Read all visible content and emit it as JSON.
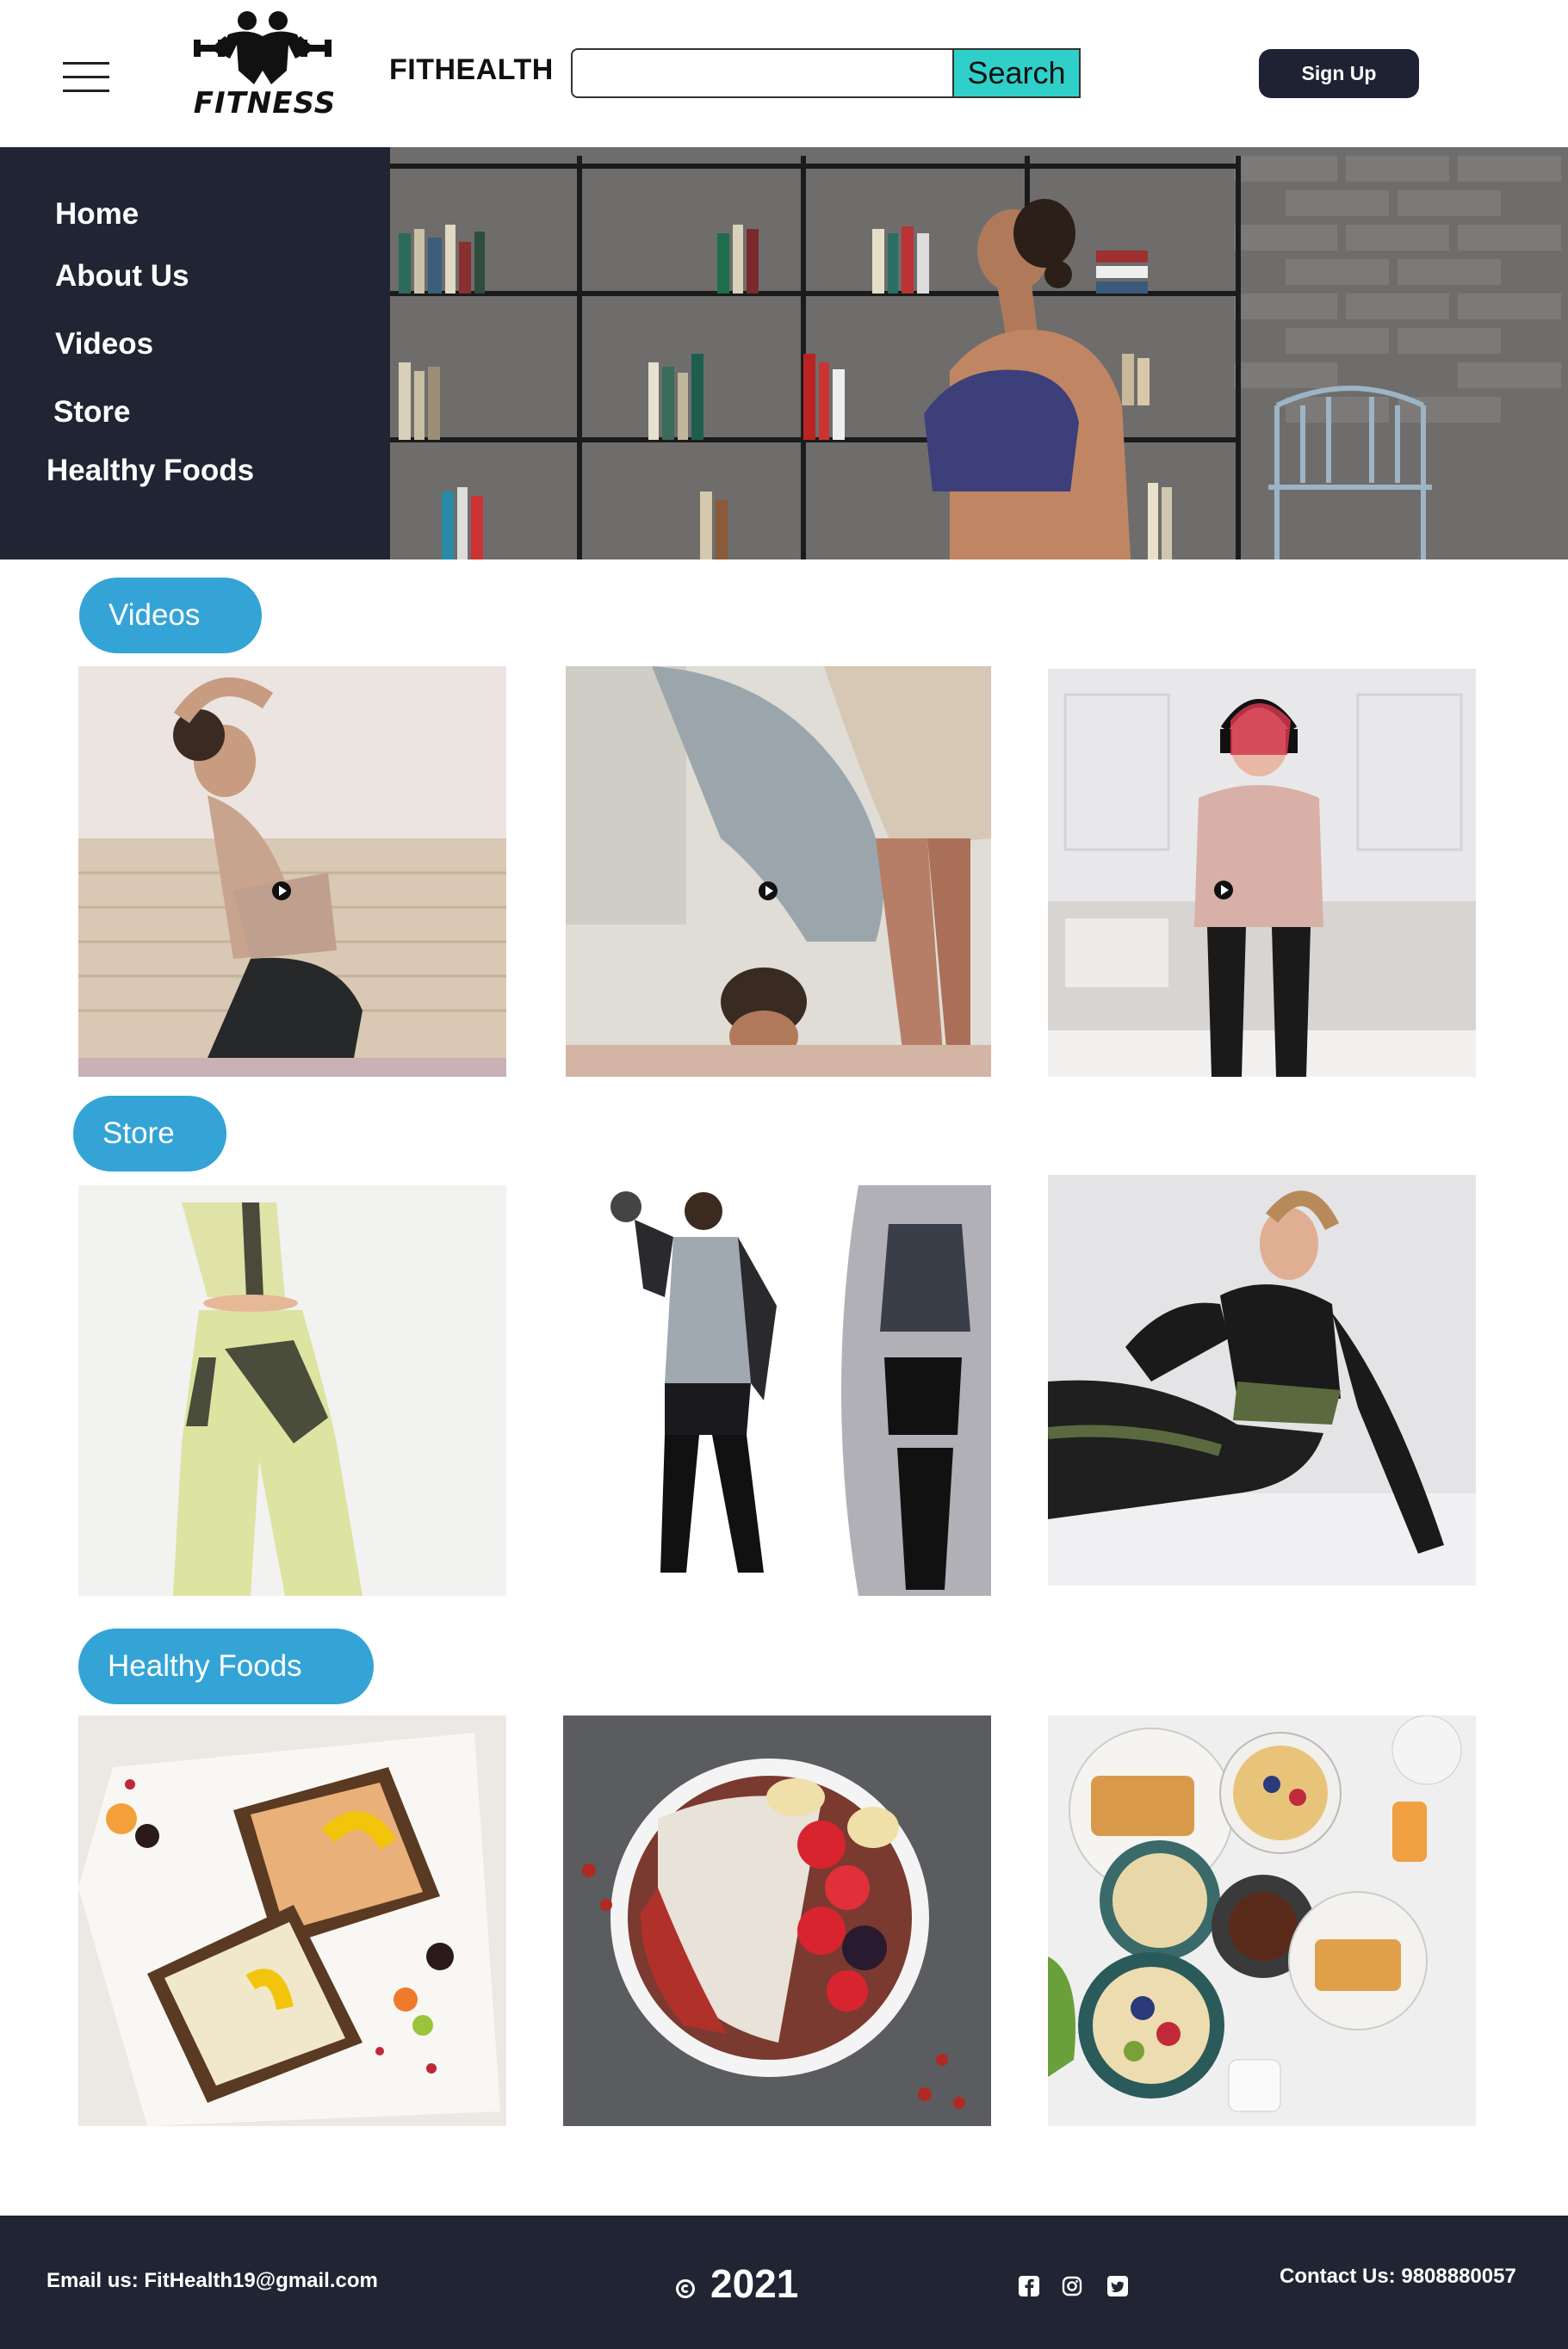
{
  "header": {
    "logo_text": "FITNESS",
    "brand": "FITHEALTH",
    "search_placeholder": "",
    "search_button": "Search",
    "signup_button": "Sign Up"
  },
  "sidebar": {
    "items": [
      {
        "label": "Home"
      },
      {
        "label": "About Us"
      },
      {
        "label": "Videos"
      },
      {
        "label": "Store"
      },
      {
        "label": "Healthy Foods"
      }
    ]
  },
  "sections": {
    "videos": "Videos",
    "store": "Store",
    "foods": "Healthy Foods"
  },
  "footer": {
    "email": "Email us: FitHealth19@gmail.com",
    "year": "2021",
    "contact": "Contact Us: 9808880057",
    "social_icons": [
      "facebook-icon",
      "instagram-icon",
      "twitter-icon"
    ]
  },
  "colors": {
    "dark": "#212432",
    "accent_pill": "#34a4d6",
    "search_button": "#2fd0c9"
  }
}
